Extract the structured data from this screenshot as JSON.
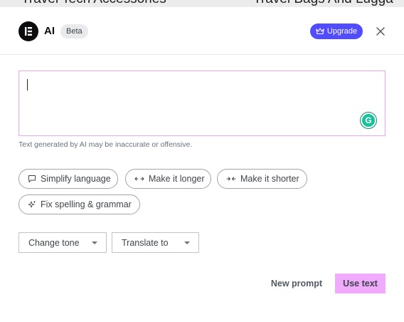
{
  "background_page": {
    "left_heading": "Travel Tech Accessories",
    "right_heading": "Travel Bags And Lugga"
  },
  "header": {
    "title": "AI",
    "badge": "Beta",
    "upgrade_label": "Upgrade",
    "icons": {
      "logo": "elementor-logo-icon",
      "upgrade": "crown-icon",
      "close": "close-icon"
    }
  },
  "prompt": {
    "value": "",
    "disclaimer": "Text generated by AI may be inaccurate or offensive.",
    "grammarly_letter": "G"
  },
  "actions": [
    {
      "label": "Simplify language",
      "icon": "speech-bubble-icon"
    },
    {
      "label": "Make it longer",
      "icon": "expand-arrows-icon"
    },
    {
      "label": "Make it shorter",
      "icon": "shrink-arrows-icon"
    },
    {
      "label": "Fix spelling & grammar",
      "icon": "sparkle-icon"
    }
  ],
  "selects": {
    "tone": "Change tone",
    "translate": "Translate to"
  },
  "footer": {
    "new_prompt": "New prompt",
    "use_text": "Use text"
  },
  "colors": {
    "accent": "#f0abfc",
    "upgrade": "#524cff",
    "prompt_border": "#eca7ee"
  }
}
